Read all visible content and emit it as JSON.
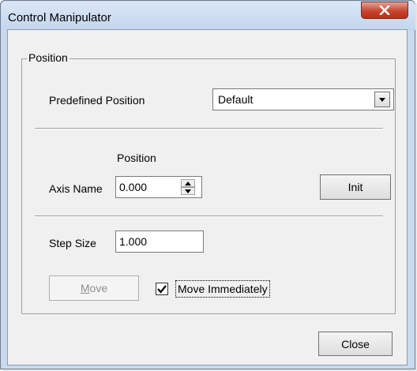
{
  "window": {
    "title": "Control Manipulator"
  },
  "group": {
    "label": "Position"
  },
  "predefined": {
    "label": "Predefined Position",
    "selected": "Default"
  },
  "axis": {
    "column_header": "Position",
    "name_label": "Axis Name",
    "value": "0.000",
    "init_label": "Init"
  },
  "step": {
    "label": "Step Size",
    "value": "1.000"
  },
  "move": {
    "button_prefix": "M",
    "button_rest": "ove",
    "enabled": false,
    "checkbox_label": "Move Immediately",
    "checked": true
  },
  "footer": {
    "close_label": "Close"
  },
  "colors": {
    "title_bar": "#c9d9ee",
    "close_button": "#c8452e",
    "client": "#f0f0f0"
  },
  "icons": [
    "close-icon",
    "dropdown-arrow-icon",
    "spin-up-icon",
    "spin-down-icon",
    "checkmark-icon"
  ]
}
